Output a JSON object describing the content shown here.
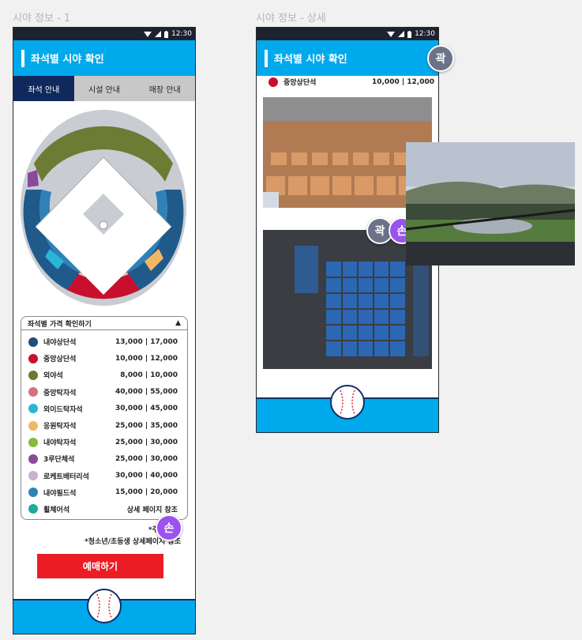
{
  "frames": {
    "left_label": "시야 정보 - 1",
    "right_label": "시야 정보 - 상세"
  },
  "statusbar": {
    "time": "12:30"
  },
  "header": {
    "title": "좌석별 시야 확인"
  },
  "tabs": [
    {
      "label": "좌석 안내",
      "active": true
    },
    {
      "label": "시설 안내",
      "active": false
    },
    {
      "label": "매장 안내",
      "active": false
    }
  ],
  "price_table": {
    "title": "좌석별 가격 확인하기",
    "toggle": "▲",
    "rows": [
      {
        "name": "내야상단석",
        "price": "13,000 | 17,000",
        "color": "#1f4e79"
      },
      {
        "name": "중앙상단석",
        "price": "10,000 | 12,000",
        "color": "#c8102e"
      },
      {
        "name": "외야석",
        "price": "8,000 | 10,000",
        "color": "#6b7b2f"
      },
      {
        "name": "중앙탁자석",
        "price": "40,000 | 55,000",
        "color": "#d4737e"
      },
      {
        "name": "외이드탁자석",
        "price": "30,000 | 45,000",
        "color": "#29b6d8"
      },
      {
        "name": "응원탁자석",
        "price": "25,000 | 35,000",
        "color": "#f2b765"
      },
      {
        "name": "내야탁자석",
        "price": "25,000 | 30,000",
        "color": "#86b93f"
      },
      {
        "name": "3루단체석",
        "price": "25,000 | 30,000",
        "color": "#8a4a9c"
      },
      {
        "name": "로케트배터리석",
        "price": "30,000 | 40,000",
        "color": "#c9afd0"
      },
      {
        "name": "내야필드석",
        "price": "15,000 | 20,000",
        "color": "#2e82b8"
      },
      {
        "name": "휠체어석",
        "price": "상세 페이지 참조",
        "color": "#20a89a"
      }
    ]
  },
  "notes": [
    "*주중/주말",
    "*청소년/초등생 상세페이지 참조"
  ],
  "book_button": "예매하기",
  "avatars": {
    "purple": "손",
    "gray": "곽"
  },
  "detail": {
    "seat_name": "중앙상단석",
    "seat_price": "10,000 | 12,000",
    "seat_color": "#c8102e"
  },
  "colors": {
    "brand": "#00a9ec",
    "navy": "#10295d",
    "red": "#ec1c24"
  }
}
